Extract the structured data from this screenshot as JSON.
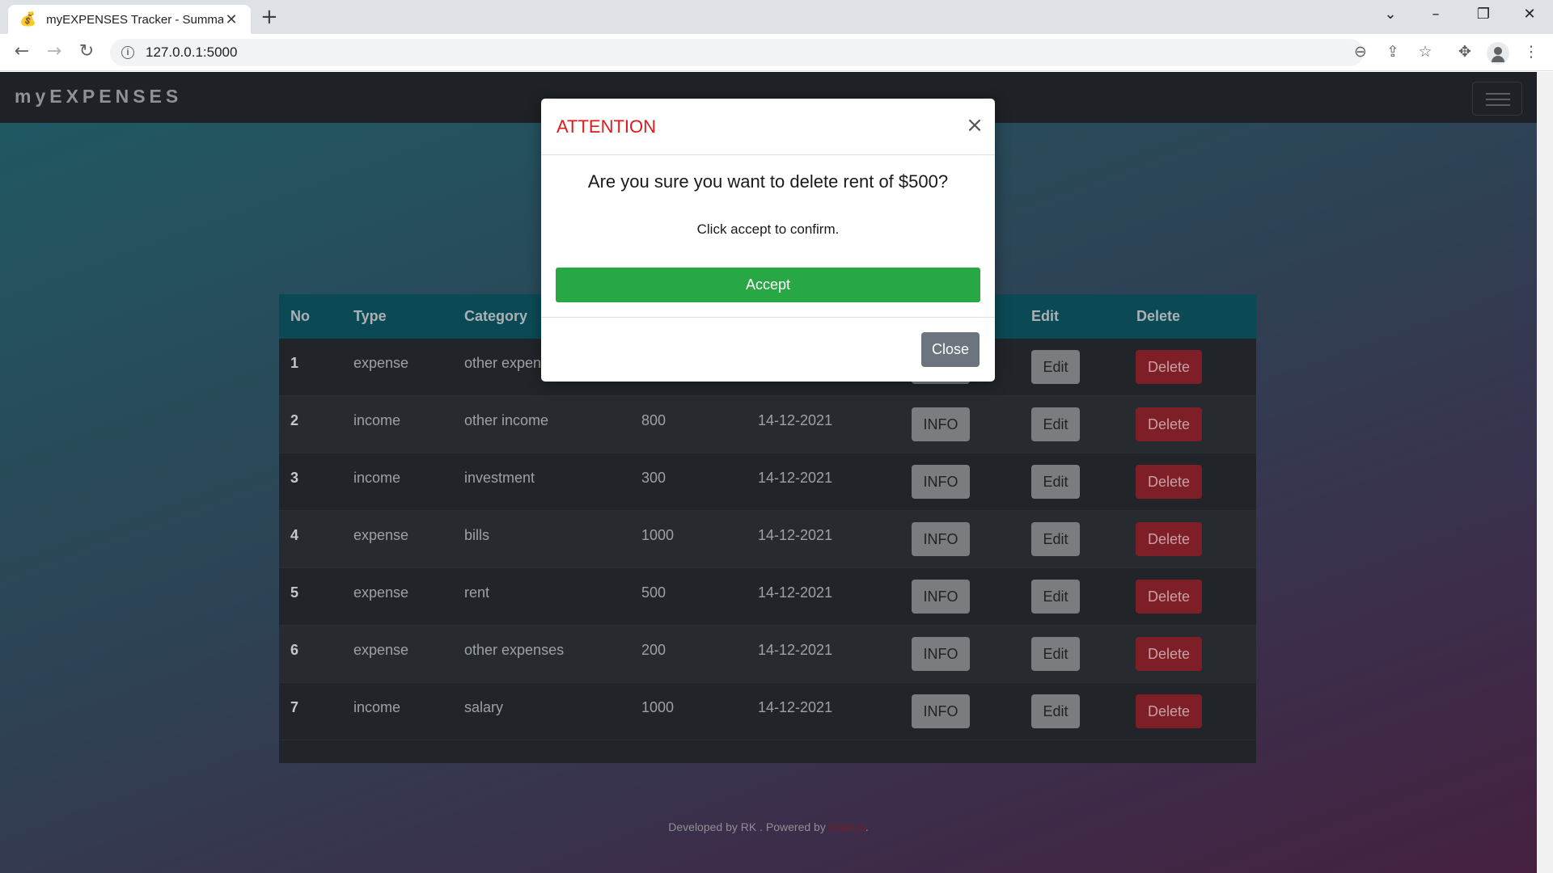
{
  "browser": {
    "tab_title": "myEXPENSES Tracker - Summary",
    "tab_favicon": "💰",
    "url": "127.0.0.1:5000"
  },
  "navbar": {
    "brand": "myEXPENSES"
  },
  "table": {
    "headers": [
      "No",
      "Type",
      "Category",
      "Edit",
      "Delete"
    ],
    "rows": [
      {
        "no": "1",
        "type": "expense",
        "category": "other expenses",
        "amount": "",
        "date": ""
      },
      {
        "no": "2",
        "type": "income",
        "category": "other income",
        "amount": "800",
        "date": "14-12-2021"
      },
      {
        "no": "3",
        "type": "income",
        "category": "investment",
        "amount": "300",
        "date": "14-12-2021"
      },
      {
        "no": "4",
        "type": "expense",
        "category": "bills",
        "amount": "1000",
        "date": "14-12-2021"
      },
      {
        "no": "5",
        "type": "expense",
        "category": "rent",
        "amount": "500",
        "date": "14-12-2021"
      },
      {
        "no": "6",
        "type": "expense",
        "category": "other expenses",
        "amount": "200",
        "date": "14-12-2021"
      },
      {
        "no": "7",
        "type": "income",
        "category": "salary",
        "amount": "1000",
        "date": "14-12-2021"
      }
    ],
    "info_label": "INFO",
    "edit_label": "Edit",
    "delete_label": "Delete"
  },
  "footer": {
    "text": "Developed by RK . Powered by ",
    "link": "chart.js",
    "end": "."
  },
  "modal": {
    "title": "ATTENTION",
    "question": "Are you sure you want to delete rent of $500?",
    "subtext": "Click accept to confirm.",
    "accept_label": "Accept",
    "close_label": "Close",
    "close_icon": "×"
  },
  "colors": {
    "accept": "#28a745",
    "delete": "#7e1f28",
    "title_red": "#e01a1a",
    "table_header": "#0b4a55"
  }
}
